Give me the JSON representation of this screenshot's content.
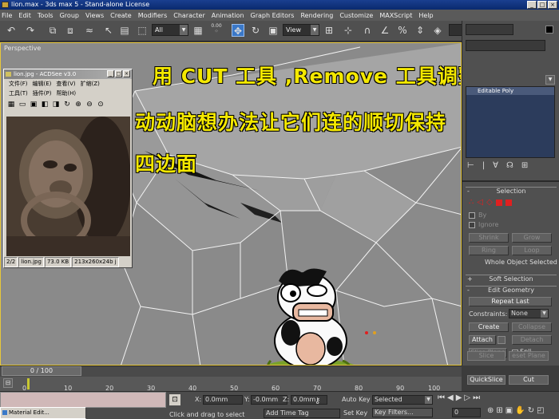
{
  "window": {
    "title": "lion.max - 3ds max 5 - Stand-alone License"
  },
  "menu": [
    "File",
    "Edit",
    "Tools",
    "Group",
    "Views",
    "Create",
    "Modifiers",
    "Character",
    "Animation",
    "Graph Editors",
    "Rendering",
    "Customize",
    "MAXScript",
    "Help"
  ],
  "toolbar": {
    "selection_filter": "All",
    "spinner_value": "0.00",
    "reference_coord": "View"
  },
  "viewport": {
    "label": "Perspective",
    "overlay_line1": "用 CUT 工具 ,Remove 工具调整 .",
    "overlay_line2": "动动脑想办法让它们连的顺切保持",
    "overlay_line3": "四边面"
  },
  "acdsee": {
    "title": "lion.jpg - ACDSee v3.0",
    "menu_row1": [
      "文件(F)",
      "编辑(E)",
      "查看(V)",
      "扩缩(Z)"
    ],
    "menu_row2": [
      "工具(T)",
      "插件(P)",
      "帮助(H)"
    ],
    "status_index": "2/2",
    "status_file": "lion.jpg",
    "status_size": "73.0 KB",
    "status_dims": "213x260x24b j"
  },
  "panel": {
    "object_name": "Editable Poly",
    "selection_header": "Selection",
    "by_label": "By",
    "ignore_label": "Ignore",
    "shrink": "Shrink",
    "grow": "Grow",
    "ring": "Ring",
    "loop": "Loop",
    "whole_object": "Whole Object Selected",
    "soft_selection": "Soft Selection",
    "edit_geometry": "Edit Geometry",
    "repeat_last": "Repeat Last",
    "constraints_label": "Constraints:",
    "constraints_value": "None",
    "create": "Create",
    "collapse": "Collapse",
    "attach": "Attach",
    "detach": "Detach",
    "slice_plane": "Slice Plane",
    "split": "Spli",
    "slice": "Slice",
    "reset_plane": "eset Plane",
    "quickslice": "QuickSlice",
    "cut": "Cut"
  },
  "timeline": {
    "frame": "0 / 100",
    "ticks": [
      "0",
      "10",
      "20",
      "30",
      "40",
      "50",
      "60",
      "70",
      "80",
      "90",
      "100"
    ]
  },
  "status": {
    "x_label": "X:",
    "x_value": "0.0mm",
    "y_label": "Y:",
    "y_value": "-0.0mm",
    "z_label": "Z:",
    "z_value": "0.0mm",
    "auto_key": "Auto Key",
    "selected": "Selected",
    "set_key": "Set Key",
    "key_filters": "Key Filters...",
    "frame_field": "0",
    "prompt": "Click and drag to select",
    "add_time_tag": "Add Time Tag"
  },
  "taskbar": {
    "material_editor": "Material Edit..."
  },
  "colors": {
    "accent": "#3a78c8",
    "overlay_text": "#f4e800",
    "viewport_border": "#e8c83a",
    "selection_red": "#e02020"
  }
}
